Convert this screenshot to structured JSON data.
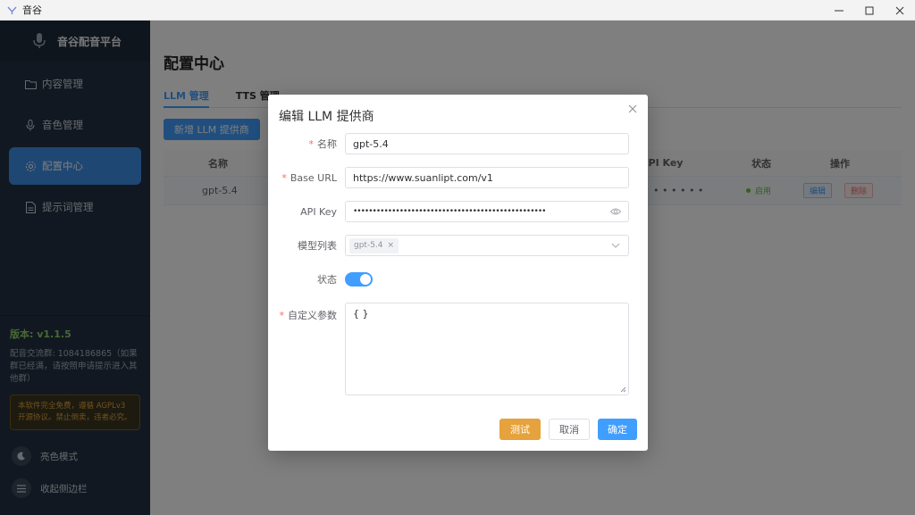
{
  "window": {
    "title": "音谷",
    "minimize": "—",
    "maximize": "☐",
    "close": "✕"
  },
  "sidebar": {
    "brand": "音谷配音平台",
    "items": [
      {
        "label": "内容管理",
        "icon": "folder-icon"
      },
      {
        "label": "音色管理",
        "icon": "mic-icon"
      },
      {
        "label": "配置中心",
        "icon": "gear-icon",
        "active": true
      },
      {
        "label": "提示词管理",
        "icon": "document-icon"
      }
    ],
    "version": "版本: v1.1.5",
    "group_info": "配音交流群: 1084186865（如果群已经满，请按照申请提示进入其他群）",
    "notice": "本软件完全免费，遵循 AGPLv3 开源协议。禁止倒卖，违者必究。",
    "theme_toggle": "亮色模式",
    "collapse": "收起侧边栏"
  },
  "main": {
    "page_title": "配置中心",
    "tabs": [
      {
        "label": "LLM 管理",
        "active": true
      },
      {
        "label": "TTS 管理"
      }
    ],
    "add_button": "新增 LLM 提供商",
    "table": {
      "headers": {
        "name": "名称",
        "api_key": "API Key",
        "status": "状态",
        "actions": "操作"
      },
      "rows": [
        {
          "name": "gpt-5.4",
          "api_key": "• • • • • •",
          "status": "启用",
          "edit": "编辑",
          "delete": "删除"
        }
      ]
    }
  },
  "dialog": {
    "title": "编辑 LLM 提供商",
    "close": "×",
    "fields": {
      "name_label": "名称",
      "name_value": "gpt-5.4",
      "base_url_label": "Base URL",
      "base_url_value": "https://www.suanlipt.com/v1",
      "api_key_label": "API Key",
      "api_key_value": "••••••••••••••••••••••••••••••••••••••••••••••••••",
      "models_label": "模型列表",
      "models": [
        "gpt-5.4"
      ],
      "chip_remove": "×",
      "status_label": "状态",
      "status_on": true,
      "params_label": "自定义参数",
      "params_value": "{ }"
    },
    "buttons": {
      "test": "测试",
      "cancel": "取消",
      "confirm": "确定"
    },
    "required_mark": "*"
  }
}
